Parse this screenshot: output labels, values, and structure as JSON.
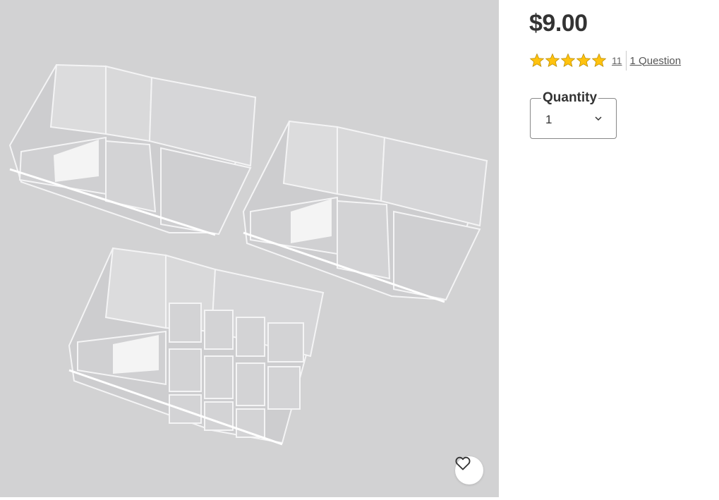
{
  "product": {
    "image_alt": "Clear acrylic cosmetic organizers",
    "price": "$9.00",
    "rating": {
      "stars": 5,
      "review_count": "11"
    },
    "questions_link": "1 Question",
    "quantity": {
      "label": "Quantity",
      "value": "1"
    }
  },
  "colors": {
    "image_background": "#d2d2d3",
    "star": "#ffc20e",
    "price_text": "#333333"
  },
  "icons": {
    "favorite": "heart-icon",
    "rating": "star-icon",
    "dropdown": "chevron-down-icon"
  }
}
